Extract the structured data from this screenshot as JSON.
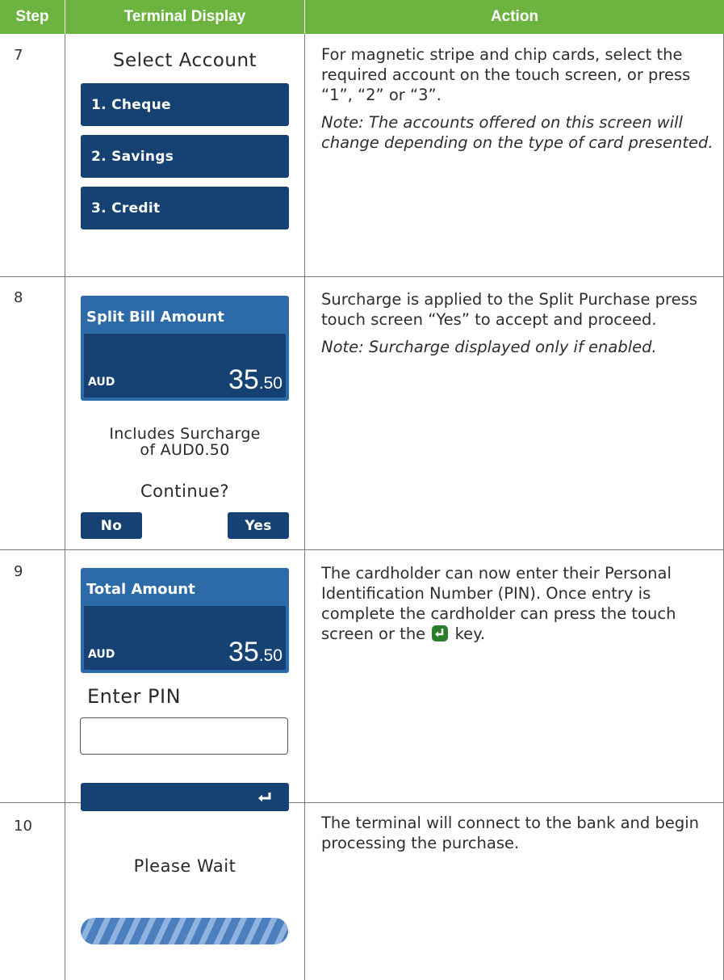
{
  "headers": {
    "step": "Step",
    "display": "Terminal Display",
    "action": "Action"
  },
  "rows": [
    {
      "step": "7",
      "screen": {
        "title": "Select Account",
        "buttons": [
          "1. Cheque",
          "2. Savings",
          "3. Credit"
        ]
      },
      "action": [
        "For magnetic stripe and chip cards, select the required account on the touch screen, or press “1”, “2” or “3”.",
        "Note: The accounts offered on this screen will change depending on the type of card presented."
      ]
    },
    {
      "step": "8",
      "screen": {
        "label": "Split Bill Amount",
        "currency": "AUD",
        "amount_main": "35",
        "amount_cents": ".50",
        "info_line1": "Includes Surcharge",
        "info_line2": "of AUD0.50",
        "question": "Continue?",
        "no": "No",
        "yes": "Yes"
      },
      "action": [
        "Surcharge is applied to the Split Purchase press touch screen “Yes” to accept and proceed.",
        "Note: Surcharge displayed only if enabled."
      ]
    },
    {
      "step": "9",
      "screen": {
        "label": "Total Amount",
        "currency": "AUD",
        "amount_main": "35",
        "amount_cents": ".50",
        "prompt": "Enter PIN",
        "enter_icon": "enter-return-icon"
      },
      "action_before": "The cardholder can now enter their Personal Identification Number (PIN). Once entry is complete the cardholder can press the touch screen or the",
      "action_after": "key."
    },
    {
      "step": "10",
      "screen": {
        "title": "Please Wait"
      },
      "action": [
        "The terminal will connect to the bank and begin processing the purchase."
      ]
    }
  ],
  "colors": {
    "header": "#6cb33f",
    "button": "#154272",
    "amount_header": "#2d6aa8",
    "enter_key": "#2a7d2a"
  }
}
